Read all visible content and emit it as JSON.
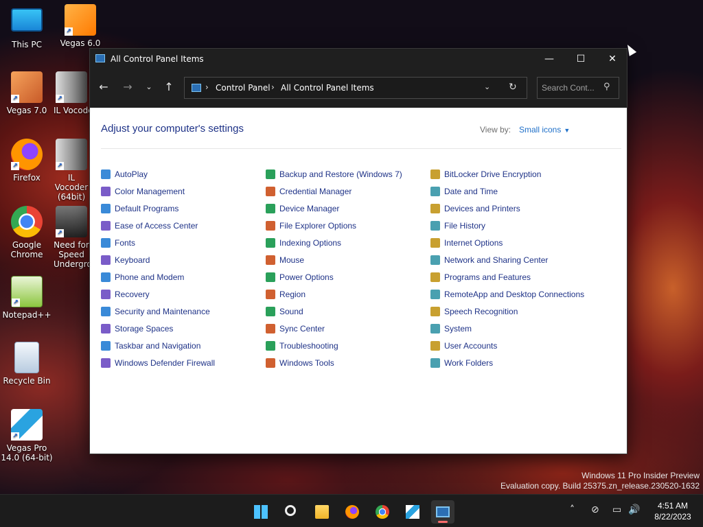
{
  "desktop": {
    "icons": [
      {
        "label": "This PC"
      },
      {
        "label": "Vegas 6.0"
      },
      {
        "label": "Vegas 7.0"
      },
      {
        "label": "IL Vocoder"
      },
      {
        "label": "Firefox"
      },
      {
        "label": "IL Vocoder (64bit)"
      },
      {
        "label": "Google Chrome"
      },
      {
        "label": "Need for Speed Underground"
      },
      {
        "label": "Notepad++"
      },
      {
        "label": "Recycle Bin"
      },
      {
        "label": "Vegas Pro 14.0 (64-bit)"
      }
    ]
  },
  "window": {
    "title": "All Control Panel Items",
    "min_glyph": "—",
    "max_glyph": "☐",
    "close_glyph": "✕"
  },
  "navbar": {
    "back_glyph": "←",
    "forward_glyph": "→",
    "recent_glyph": "⌄",
    "up_glyph": "↑",
    "breadcrumbs": [
      "Control Panel",
      "All Control Panel Items"
    ],
    "separator": "›",
    "dropdown_glyph": "⌄",
    "refresh_glyph": "↻",
    "search_placeholder": "Search Cont...",
    "search_glyph": "⚲"
  },
  "content": {
    "heading": "Adjust your computer's settings",
    "view_by_label": "View by:",
    "view_by_value": "Small icons",
    "items": [
      [
        "AutoPlay",
        "Backup and Restore (Windows 7)",
        "BitLocker Drive Encryption"
      ],
      [
        "Color Management",
        "Credential Manager",
        "Date and Time"
      ],
      [
        "Default Programs",
        "Device Manager",
        "Devices and Printers"
      ],
      [
        "Ease of Access Center",
        "File Explorer Options",
        "File History"
      ],
      [
        "Fonts",
        "Indexing Options",
        "Internet Options"
      ],
      [
        "Keyboard",
        "Mouse",
        "Network and Sharing Center"
      ],
      [
        "Phone and Modem",
        "Power Options",
        "Programs and Features"
      ],
      [
        "Recovery",
        "Region",
        "RemoteApp and Desktop Connections"
      ],
      [
        "Security and Maintenance",
        "Sound",
        "Speech Recognition"
      ],
      [
        "Storage Spaces",
        "Sync Center",
        "System"
      ],
      [
        "Taskbar and Navigation",
        "Troubleshooting",
        "User Accounts"
      ],
      [
        "Windows Defender Firewall",
        "Windows Tools",
        "Work Folders"
      ]
    ]
  },
  "watermark": {
    "line1": "Windows 11 Pro Insider Preview",
    "line2": "Evaluation copy. Build 25375.zn_release.230520-1632"
  },
  "taskbar": {
    "apps": [
      "start-icon",
      "search-icon",
      "file-explorer-icon",
      "firefox-icon",
      "chrome-icon",
      "vegas-pro-icon",
      "control-panel-icon"
    ],
    "tray_chevron": "˄",
    "tray_network": "⊘",
    "tray_display": "▭",
    "tray_volume": "🔊",
    "time": "4:51 AM",
    "date": "8/22/2023"
  },
  "colors": {
    "link_blue": "#1e3287",
    "accent_blue": "#1e6fc8",
    "titlebar": "#1f1f1f",
    "active_indicator": "#ff6b6b"
  }
}
